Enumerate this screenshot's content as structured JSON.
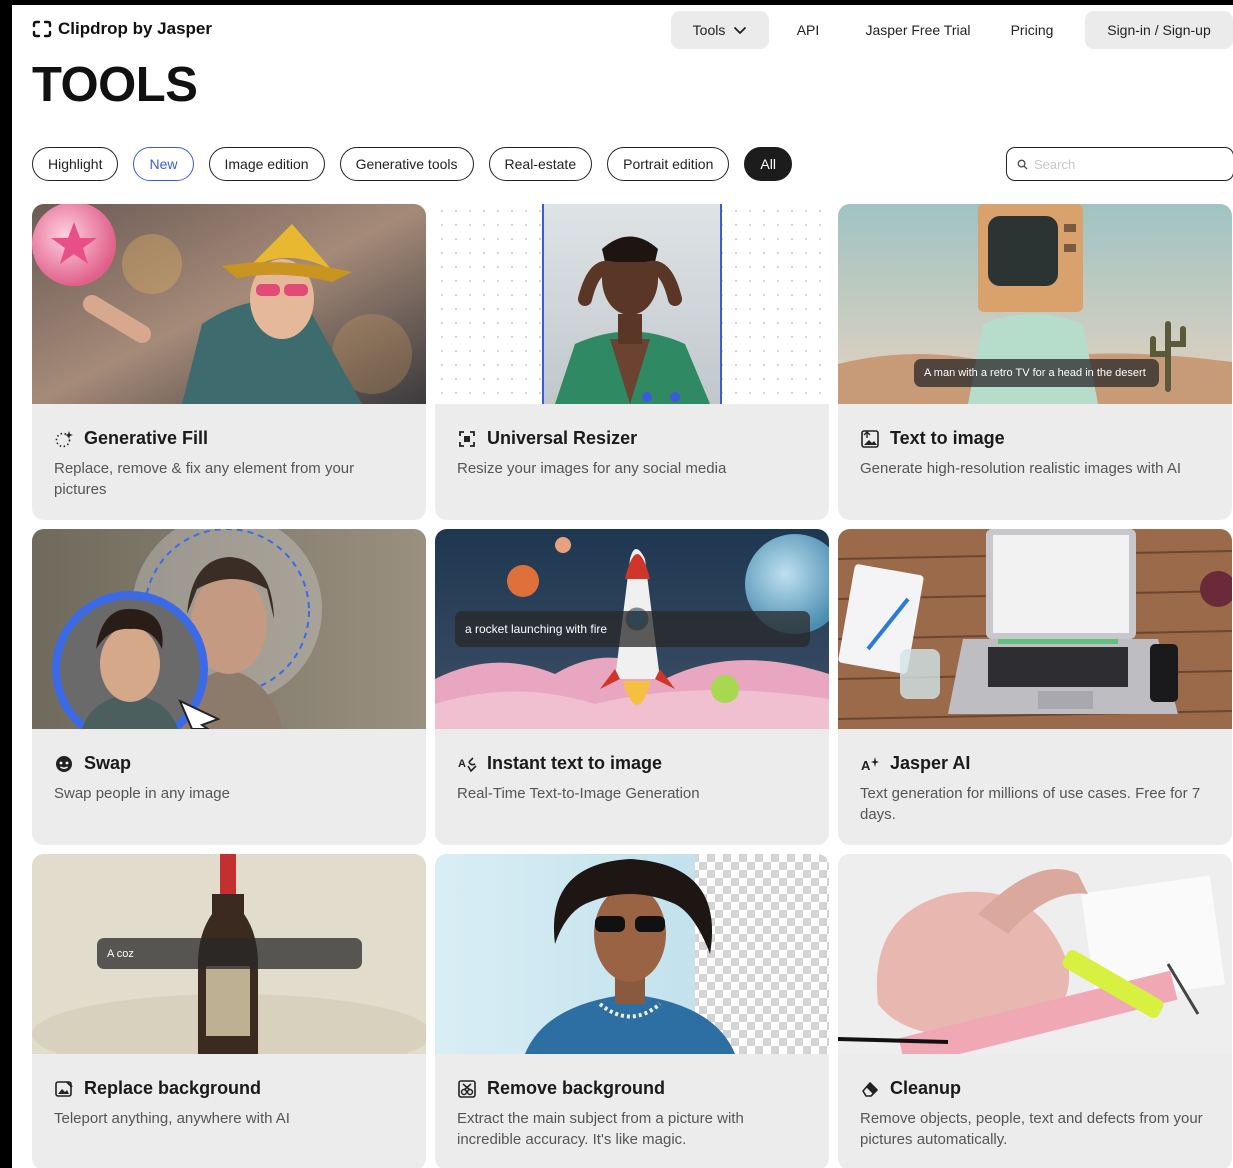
{
  "brand": {
    "name": "Clipdrop by Jasper"
  },
  "nav": {
    "tools": "Tools",
    "api": "API",
    "trial": "Jasper Free Trial",
    "pricing": "Pricing",
    "sign": "Sign-in / Sign-up"
  },
  "page": {
    "title": "TOOLS"
  },
  "filters": [
    "Highlight",
    "New",
    "Image edition",
    "Generative tools",
    "Real-estate",
    "Portrait edition",
    "All"
  ],
  "search": {
    "placeholder": "Search"
  },
  "cards": [
    {
      "title": "Generative Fill",
      "desc": "Replace, remove & fix any element from your pictures",
      "icon": "sparkle-dotted-circle-icon"
    },
    {
      "title": "Universal Resizer",
      "desc": "Resize your images for any social media",
      "icon": "resize-frame-icon"
    },
    {
      "title": "Text to image",
      "desc": "Generate high-resolution realistic images with AI",
      "icon": "text-image-icon",
      "overlay": "A man with a retro TV for a head in the desert"
    },
    {
      "title": "Swap",
      "desc": "Swap people in any image",
      "icon": "face-swap-icon"
    },
    {
      "title": "Instant text to image",
      "desc": "Real-Time Text-to-Image Generation",
      "icon": "instant-text-icon",
      "overlay": "a rocket launching with fire"
    },
    {
      "title": "Jasper AI",
      "desc": "Text generation for millions of use cases. Free for 7 days.",
      "icon": "ai-sparkle-icon"
    },
    {
      "title": "Replace background",
      "desc": "Teleport anything, anywhere with AI",
      "icon": "image-edit-icon",
      "overlay": "A coz"
    },
    {
      "title": "Remove background",
      "desc": "Extract the main subject from a picture with incredible accuracy. It's like magic.",
      "icon": "cutout-icon"
    },
    {
      "title": "Cleanup",
      "desc": "Remove objects, people, text and defects from your pictures automatically.",
      "icon": "eraser-icon"
    }
  ],
  "colors": {
    "accent": "#3b5bdb",
    "card_bg": "#ececec",
    "active_pill": "#1c1c1c"
  }
}
